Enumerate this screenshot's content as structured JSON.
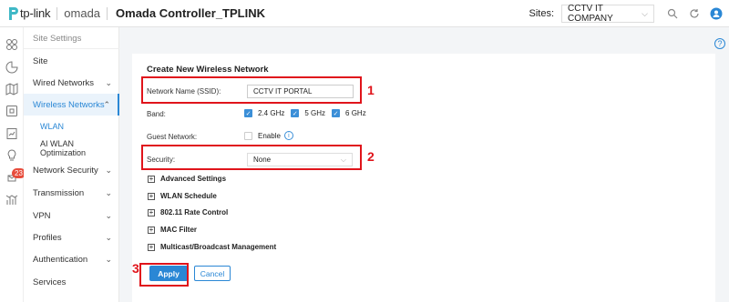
{
  "header": {
    "brand_tp": "tp-link",
    "brand_omada": "omada",
    "controller": "Omada Controller_TPLINK",
    "sites_label": "Sites:",
    "site_selected": "CCTV IT COMPANY",
    "icons": [
      "search-icon",
      "refresh-icon",
      "user-icon"
    ]
  },
  "rail": {
    "badge": "23",
    "icons": [
      "dashboard-icon",
      "stats-icon",
      "map-icon",
      "devices-icon",
      "logs-icon",
      "insight-icon",
      "alerts-icon",
      "reports-icon"
    ]
  },
  "sidebar": {
    "items": [
      {
        "label": "Site Settings"
      },
      {
        "label": "Site"
      },
      {
        "label": "Wired Networks"
      },
      {
        "label": "Wireless Networks"
      },
      {
        "label": "WLAN"
      },
      {
        "label": "AI WLAN Optimization"
      },
      {
        "label": "Network Security"
      },
      {
        "label": "Transmission"
      },
      {
        "label": "VPN"
      },
      {
        "label": "Profiles"
      },
      {
        "label": "Authentication"
      },
      {
        "label": "Services"
      }
    ]
  },
  "form": {
    "title": "Create New Wireless Network",
    "ssid_label": "Network Name (SSID):",
    "ssid_value": "CCTV IT PORTAL",
    "band_label": "Band:",
    "bands": [
      "2.4 GHz",
      "5 GHz",
      "6 GHz"
    ],
    "guest_label": "Guest Network:",
    "guest_enable": "Enable",
    "security_label": "Security:",
    "security_value": "None",
    "sections": [
      "Advanced Settings",
      "WLAN Schedule",
      "802.11 Rate Control",
      "MAC Filter",
      "Multicast/Broadcast Management"
    ],
    "apply": "Apply",
    "cancel": "Cancel"
  },
  "annotations": [
    "1",
    "2",
    "3"
  ],
  "colors": {
    "accent": "#2a87d5",
    "highlight": "#e0141b",
    "badge": "#e74c3c"
  }
}
